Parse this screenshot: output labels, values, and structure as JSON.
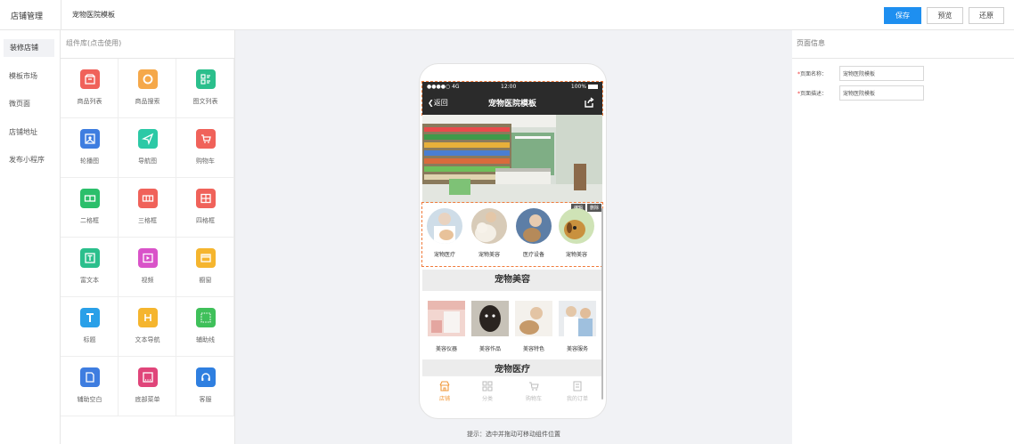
{
  "topbar": {
    "brand": "店铺管理",
    "page_name": "宠物医院模板",
    "save_label": "保存",
    "preview_label": "预览",
    "restore_label": "还原",
    "accent": "#1e8ff0"
  },
  "leftnav": {
    "items": [
      "装修店铺",
      "模板市场",
      "微页面",
      "店铺地址",
      "发布小程序"
    ],
    "active_index": 0
  },
  "complib": {
    "header": "组件库(点击使用)",
    "items": [
      {
        "label": "商品列表",
        "icon": "shop-box-icon",
        "color": "#f0625a"
      },
      {
        "label": "商品搜索",
        "icon": "search-circle-icon",
        "color": "#f5a84a"
      },
      {
        "label": "图文列表",
        "icon": "image-text-list-icon",
        "color": "#2bbf8c"
      },
      {
        "label": "轮播图",
        "icon": "carousel-icon",
        "color": "#3e7de0"
      },
      {
        "label": "导航图",
        "icon": "navigation-icon",
        "color": "#2cc9a6"
      },
      {
        "label": "购物车",
        "icon": "cart-icon",
        "color": "#f0625a"
      },
      {
        "label": "二格框",
        "icon": "two-grid-icon",
        "color": "#2bbf6b"
      },
      {
        "label": "三格框",
        "icon": "three-grid-icon",
        "color": "#f0625a"
      },
      {
        "label": "四格框",
        "icon": "four-grid-icon",
        "color": "#f0625a"
      },
      {
        "label": "富文本",
        "icon": "rich-text-icon",
        "color": "#2bbf8c"
      },
      {
        "label": "视频",
        "icon": "video-icon",
        "color": "#d953c9"
      },
      {
        "label": "橱窗",
        "icon": "showcase-icon",
        "color": "#f5b52e"
      },
      {
        "label": "标题",
        "icon": "title-icon",
        "color": "#2aa0e8"
      },
      {
        "label": "文本导航",
        "icon": "text-nav-icon",
        "color": "#f5b52e"
      },
      {
        "label": "辅助线",
        "icon": "guide-line-icon",
        "color": "#3fc05a"
      },
      {
        "label": "辅助空白",
        "icon": "blank-icon",
        "color": "#3e7de0"
      },
      {
        "label": "底部菜单",
        "icon": "bottom-menu-icon",
        "color": "#e0457a"
      },
      {
        "label": "客服",
        "icon": "headset-icon",
        "color": "#2f7fe0"
      }
    ]
  },
  "phone": {
    "status_left": "●●●●○ 4G",
    "status_time": "12:00",
    "status_battery": "100%",
    "back_label": "返回",
    "title": "宠物医院模板",
    "edit_label": "编辑",
    "delete_label": "删除",
    "categories": [
      "宠物医疗",
      "宠物美容",
      "医疗设备",
      "宠物美容"
    ],
    "section1_title": "宠物美容",
    "products": [
      "美容仪器",
      "美容作品",
      "美容特色",
      "美容服务"
    ],
    "section2_title": "宠物医疗",
    "tabs": [
      {
        "label": "店铺",
        "icon": "store-icon",
        "active": true
      },
      {
        "label": "分类",
        "icon": "category-icon",
        "active": false
      },
      {
        "label": "购物车",
        "icon": "cart-icon",
        "active": false
      },
      {
        "label": "我的订单",
        "icon": "orders-icon",
        "active": false
      }
    ]
  },
  "canvas": {
    "hint": "提示：选中并拖动可移动组件位置"
  },
  "rightpanel": {
    "header": "页面信息",
    "fields": [
      {
        "label": "页面名称：",
        "value": "宠物医院模板"
      },
      {
        "label": "页面描述：",
        "value": "宠物医院模板"
      }
    ]
  }
}
